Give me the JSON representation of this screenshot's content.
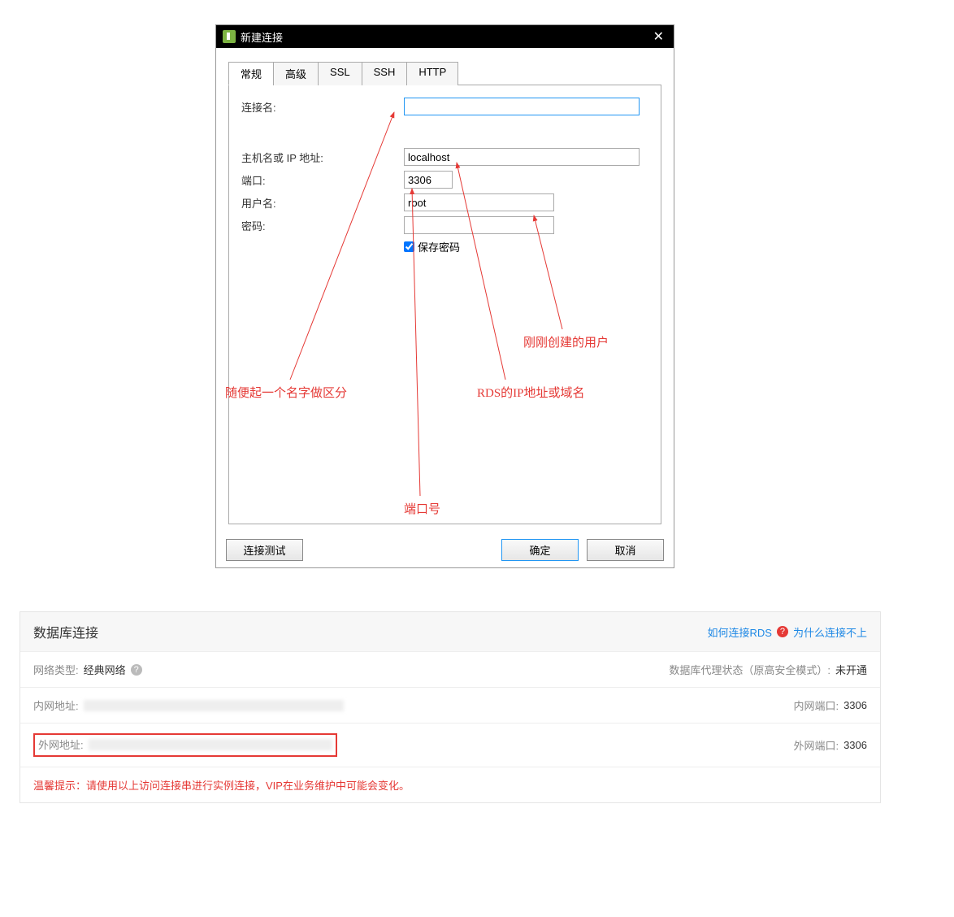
{
  "dialog": {
    "title": "新建连接",
    "tabs": [
      "常规",
      "高级",
      "SSL",
      "SSH",
      "HTTP"
    ],
    "fields": {
      "conn_name_label": "连接名:",
      "conn_name_value": "",
      "host_label": "主机名或 IP 地址:",
      "host_value": "localhost",
      "port_label": "端口:",
      "port_value": "3306",
      "user_label": "用户名:",
      "user_value": "root",
      "pass_label": "密码:",
      "pass_value": "",
      "save_pass_label": "保存密码"
    },
    "buttons": {
      "test": "连接测试",
      "ok": "确定",
      "cancel": "取消"
    }
  },
  "annotations": {
    "name_hint": "随便起一个名字做区分",
    "host_hint": "RDS的IP地址或域名",
    "port_hint": "端口号",
    "user_hint": "刚刚创建的用户"
  },
  "panel": {
    "title": "数据库连接",
    "link_how": "如何连接RDS",
    "link_why": "为什么连接不上",
    "net_type_label": "网络类型:",
    "net_type_value": "经典网络",
    "proxy_label": "数据库代理状态（原高安全模式）:",
    "proxy_value": "未开通",
    "inner_addr_label": "内网地址:",
    "inner_port_label": "内网端口:",
    "inner_port_value": "3306",
    "outer_addr_label": "外网地址:",
    "outer_port_label": "外网端口:",
    "outer_port_value": "3306",
    "tip": "温馨提示：请使用以上访问连接串进行实例连接，VIP在业务维护中可能会变化。"
  }
}
